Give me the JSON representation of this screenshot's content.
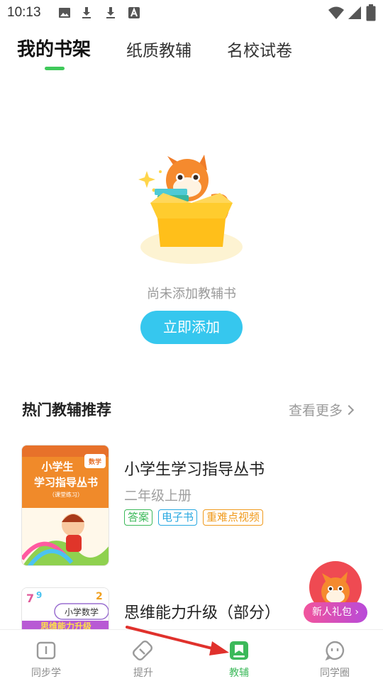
{
  "status_bar": {
    "time": "10:13",
    "left_icons": [
      "image-icon",
      "download-icon",
      "download-icon",
      "font-icon"
    ],
    "right_icons": [
      "wifi-icon",
      "signal-icon",
      "battery-icon"
    ]
  },
  "top_tabs": [
    {
      "label": "我的书架",
      "active": true
    },
    {
      "label": "纸质教辅",
      "active": false
    },
    {
      "label": "名校试卷",
      "active": false
    }
  ],
  "empty_state": {
    "message": "尚未添加教辅书",
    "button_label": "立即添加"
  },
  "recommend": {
    "title": "热门教辅推荐",
    "more_label": "查看更多",
    "books": [
      {
        "title": "小学生学习指导丛书",
        "subtitle": "二年级上册",
        "tags": [
          {
            "label": "答案",
            "color": "green"
          },
          {
            "label": "电子书",
            "color": "blue"
          },
          {
            "label": "重难点视频",
            "color": "orange"
          }
        ],
        "cover": {
          "line1": "小学生",
          "line2": "学习指导丛书",
          "badge": "数学",
          "sub": "（课堂练习）"
        }
      },
      {
        "title": "思维能力升级（部分）",
        "subtitle": "",
        "tags": [],
        "cover": {
          "line1": "小学数学",
          "line2": "思维能力升级"
        }
      }
    ]
  },
  "gift": {
    "label": "新人礼包"
  },
  "bottom_nav": [
    {
      "label": "同步学",
      "icon": "book-open-icon",
      "active": false
    },
    {
      "label": "提升",
      "icon": "eraser-icon",
      "active": false
    },
    {
      "label": "教辅",
      "icon": "bookmark-book-icon",
      "active": true
    },
    {
      "label": "同学圈",
      "icon": "chat-face-icon",
      "active": false
    }
  ],
  "colors": {
    "accent_green": "#3fc95a",
    "button_blue": "#36c7ee",
    "annotation_red": "#e0312c"
  }
}
